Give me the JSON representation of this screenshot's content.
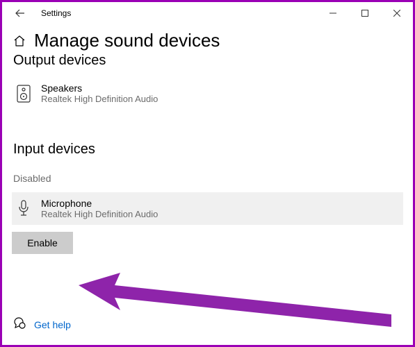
{
  "window": {
    "title": "Settings"
  },
  "page": {
    "title": "Manage sound devices"
  },
  "output_section": {
    "heading": "Output devices",
    "device": {
      "name": "Speakers",
      "sub": "Realtek High Definition Audio"
    }
  },
  "input_section": {
    "heading": "Input devices",
    "status": "Disabled",
    "device": {
      "name": "Microphone",
      "sub": "Realtek High Definition Audio"
    },
    "enable_label": "Enable"
  },
  "help": {
    "label": "Get help"
  }
}
